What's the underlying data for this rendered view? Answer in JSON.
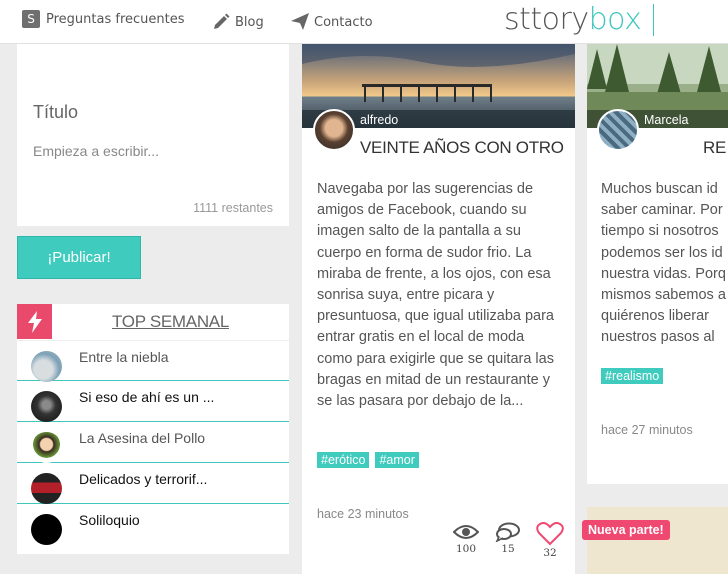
{
  "nav": {
    "faq_icon": "S",
    "faq": "Preguntas frecuentes",
    "blog": "Blog",
    "contact": "Contacto"
  },
  "logo": {
    "part1": "sttory",
    "part2": "box"
  },
  "compose": {
    "title_placeholder": "Título",
    "body_placeholder": "Empieza a escribir...",
    "remaining": "1111 restantes"
  },
  "publish_label": "¡Publicar!",
  "top_weekly": {
    "title": "TOP SEMANAL",
    "items": [
      {
        "label": "Entre la niebla"
      },
      {
        "label": "Si eso de ahí es un ..."
      },
      {
        "label": "La Asesina del Pollo"
      },
      {
        "label": "Delicados y terrorif..."
      },
      {
        "label": "Soliloquio"
      }
    ]
  },
  "cards": [
    {
      "author": "alfredo",
      "title": "VEINTE AÑOS CON OTRO",
      "text": "Navegaba por las sugerencias de amigos de Facebook, cuando su imagen salto de la pantalla a su cuerpo en forma de sudor frio. La miraba de frente, a los ojos, con esa sonrisa suya, entre picara y presuntuosa, que igual utilizaba para entrar gratis en el local de moda como para exigirle que se quitara las bragas en mitad de un restaurante y se las pasara por debajo de la...",
      "tags": [
        "#erótico",
        "#amor"
      ],
      "time": "hace 23 minutos",
      "views": "100",
      "comments": "15",
      "likes": "32"
    },
    {
      "author": "Marcela",
      "title": "RE",
      "text": "Muchos buscan id saber caminar. Por tiempo si nosotros podemos ser los id nuestra vidas. Porq mismos sabemos a quiérenos liberar nuestros pasos al",
      "tags": [
        "#realismo"
      ],
      "time": "hace 27 minutos"
    }
  ],
  "badge": "Nueva parte!",
  "colors": {
    "accent": "#3fcbbe",
    "pink": "#ef4871"
  }
}
